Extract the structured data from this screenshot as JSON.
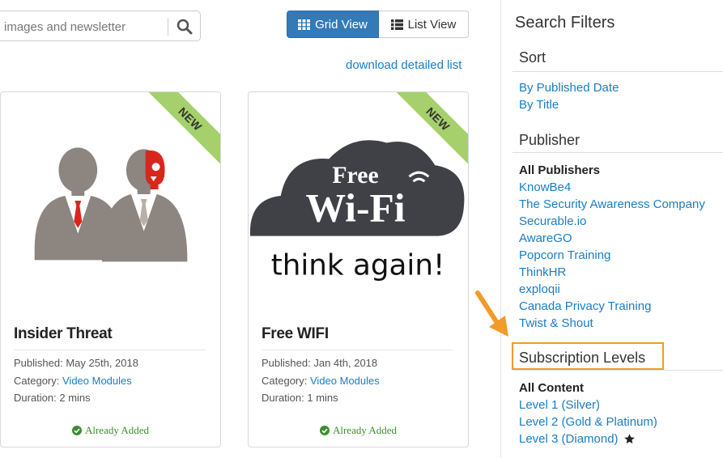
{
  "search": {
    "placeholder": "images and newsletter"
  },
  "view_toggle": {
    "grid_label": "Grid View",
    "list_label": "List View"
  },
  "download_link": "download detailed list",
  "cards": [
    {
      "ribbon": "NEW",
      "title": "Insider Threat",
      "published_label": "Published:",
      "published": "May 25th, 2018",
      "category_label": "Category:",
      "category": "Video Modules",
      "duration_label": "Duration:",
      "duration": "2 mins",
      "status": "Already Added"
    },
    {
      "ribbon": "NEW",
      "title": "Free WIFI",
      "published_label": "Published:",
      "published": "Jan 4th, 2018",
      "category_label": "Category:",
      "category": "Video Modules",
      "duration_label": "Duration:",
      "duration": "1 mins",
      "status": "Already Added",
      "image_text": {
        "line1": "Free",
        "line2": "Wi-Fi",
        "line3": "think again!"
      }
    }
  ],
  "sidebar": {
    "title": "Search Filters",
    "sort": {
      "heading": "Sort",
      "items": [
        "By Published Date",
        "By Title"
      ]
    },
    "publisher": {
      "heading": "Publisher",
      "current": "All Publishers",
      "items": [
        "KnowBe4",
        "The Security Awareness Company",
        "Securable.io",
        "AwareGO",
        "Popcorn Training",
        "ThinkHR",
        "exploqii",
        "Canada Privacy Training",
        "Twist & Shout"
      ]
    },
    "subscription": {
      "heading": "Subscription Levels",
      "current": "All Content",
      "items": [
        "Level 1 (Silver)",
        "Level 2 (Gold & Platinum)",
        "Level 3 (Diamond)"
      ]
    }
  },
  "colors": {
    "primary": "#337ab7",
    "link": "#1a7dc4",
    "ribbon": "#a6d06b",
    "highlight": "#f39a2a",
    "success": "#3c8d2f"
  }
}
